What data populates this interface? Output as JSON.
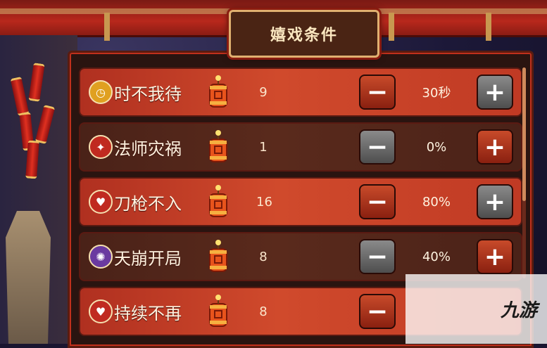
{
  "title": "嬉戏条件",
  "rules": [
    {
      "name": "时不我待",
      "icon": "clock-icon",
      "count": "9",
      "value": "30秒",
      "active": true,
      "minus_style": "red",
      "plus_style": "dark"
    },
    {
      "name": "法师灾祸",
      "icon": "shield-curse-icon",
      "count": "1",
      "value": "0%",
      "active": false,
      "minus_style": "dark",
      "plus_style": "red"
    },
    {
      "name": "刀枪不入",
      "icon": "shield-heart-icon",
      "count": "16",
      "value": "80%",
      "active": true,
      "minus_style": "red",
      "plus_style": "dark"
    },
    {
      "name": "天崩开局",
      "icon": "meteor-icon",
      "count": "8",
      "value": "40%",
      "active": false,
      "minus_style": "dark",
      "plus_style": "red"
    },
    {
      "name": "持续不再",
      "icon": "heart-break-icon",
      "count": "8",
      "value": "",
      "active": true,
      "minus_style": "red",
      "plus_style": "dark"
    }
  ],
  "controls": {
    "minus_symbol": "−",
    "plus_symbol": "+"
  },
  "watermark": "九游",
  "colors": {
    "active_row": "#c03a24",
    "inactive_row": "#4a2218",
    "title_text": "#fbe7c0"
  }
}
